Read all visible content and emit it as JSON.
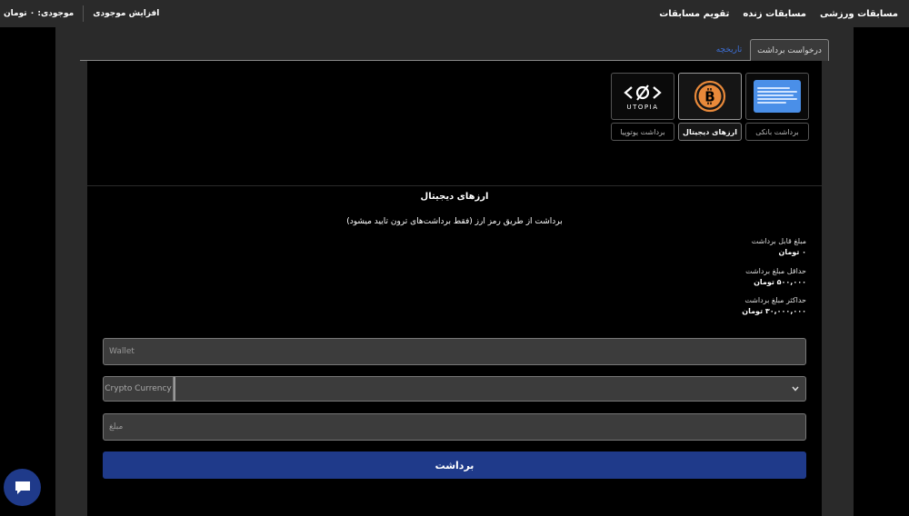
{
  "topbar": {
    "nav": [
      "مسابقات ورزشی",
      "مسابقات زنده",
      "تقویم مسابقات"
    ],
    "balance": "موجودی: ۰ تومان",
    "add_funds": "افزایش موجودی"
  },
  "tabs": {
    "withdraw_request": "درخواست برداشت",
    "history": "تاریخچه"
  },
  "methods": [
    {
      "icon": "bank-card-icon",
      "label": "برداشت بانکی",
      "selected": false
    },
    {
      "icon": "bitcoin-icon",
      "label": "ارزهای دیجیتال",
      "selected": true
    },
    {
      "icon": "utopia-logo-icon",
      "label": "برداشت یوتوپیا",
      "selected": false,
      "logo_text": "UTOPIA"
    }
  ],
  "section": {
    "title": "ارزهای دیجیتال",
    "description": "برداشت از طریق رمز ارز (فقط برداشت‌های ترون تایید میشود)"
  },
  "info": [
    {
      "label": "مبلغ قابل برداشت",
      "value": "۰ تومان"
    },
    {
      "label": "حداقل مبلغ برداشت",
      "value": "۵۰۰,۰۰۰ تومان"
    },
    {
      "label": "حداکثر مبلغ برداشت",
      "value": "۳۰,۰۰۰,۰۰۰ تومان"
    }
  ],
  "form": {
    "wallet_placeholder": "Wallet",
    "crypto_label": "Crypto Currency",
    "amount_placeholder": "مبلغ",
    "submit_label": "برداشت"
  },
  "colors": {
    "accent": "#1f3a8a",
    "link": "#3d6fd6",
    "bank_card": "#4a8fe8",
    "bitcoin": "#e8893a"
  }
}
